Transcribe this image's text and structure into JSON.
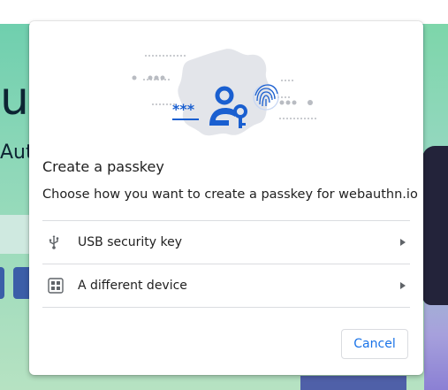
{
  "background_page": {
    "heading_fragment": "ut",
    "subheading_fragment": "Aut"
  },
  "dialog": {
    "title": "Create a passkey",
    "subtitle": "Choose how you want to create a passkey for webauthn.io",
    "illustration": {
      "password_glyph": "***",
      "icons": [
        "person-key-icon",
        "fingerprint-icon"
      ]
    },
    "options": [
      {
        "icon": "usb-icon",
        "label": "USB security key"
      },
      {
        "icon": "qr-code-icon",
        "label": "A different device"
      }
    ],
    "cancel_label": "Cancel"
  },
  "colors": {
    "accent": "#1a73e8",
    "illustration_blue": "#1a5fd0",
    "blob_gray": "#e3e5ea"
  }
}
